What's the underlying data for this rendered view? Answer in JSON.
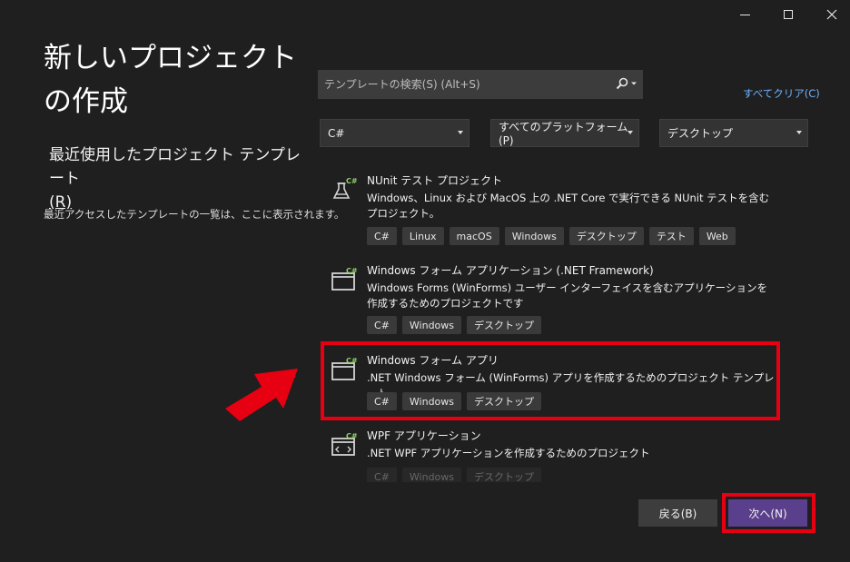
{
  "window": {
    "minimize_icon": "minimize-icon",
    "maximize_icon": "maximize-icon",
    "close_icon": "close-icon"
  },
  "page": {
    "title": "新しいプロジェクトの作成",
    "recent_title": "最近使用したプロジェクト テンプレート",
    "recent_accel": "(R)",
    "recent_desc": "最近アクセスしたテンプレートの一覧は、ここに表示されます。"
  },
  "search": {
    "placeholder": "テンプレートの検索(S) (Alt+S)",
    "value": ""
  },
  "clear_all": "すべてクリア(C)",
  "filters": {
    "language": "C#",
    "platform": "すべてのプラットフォーム(P)",
    "project_type": "デスクトップ"
  },
  "templates": [
    {
      "name": "NUnit テスト プロジェクト",
      "description": "Windows、Linux および MacOS 上の .NET Core で実行できる NUnit テストを含むプロジェクト。",
      "tags": [
        "C#",
        "Linux",
        "macOS",
        "Windows",
        "デスクトップ",
        "テスト",
        "Web"
      ],
      "icon": "nunit-test-icon"
    },
    {
      "name": "Windows フォーム アプリケーション (.NET Framework)",
      "description": "Windows Forms (WinForms) ユーザー インターフェイスを含むアプリケーションを作成するためのプロジェクトです",
      "tags": [
        "C#",
        "Windows",
        "デスクトップ"
      ],
      "icon": "windows-form-icon"
    },
    {
      "name": "Windows フォーム アプリ",
      "description": ".NET Windows フォーム (WinForms) アプリを作成するためのプロジェクト テンプレート。",
      "tags": [
        "C#",
        "Windows",
        "デスクトップ"
      ],
      "icon": "windows-form-icon"
    },
    {
      "name": "WPF アプリケーション",
      "description": ".NET WPF アプリケーションを作成するためのプロジェクト",
      "tags": [
        "C#",
        "Windows",
        "デスクトップ"
      ],
      "icon": "wpf-app-icon"
    }
  ],
  "buttons": {
    "back": "戻る(B)",
    "next": "次へ(N)"
  },
  "colors": {
    "background": "#1f1f1f",
    "highlight": "#e60012",
    "primary_button": "#5a3f8c",
    "link": "#6fb2ff"
  }
}
